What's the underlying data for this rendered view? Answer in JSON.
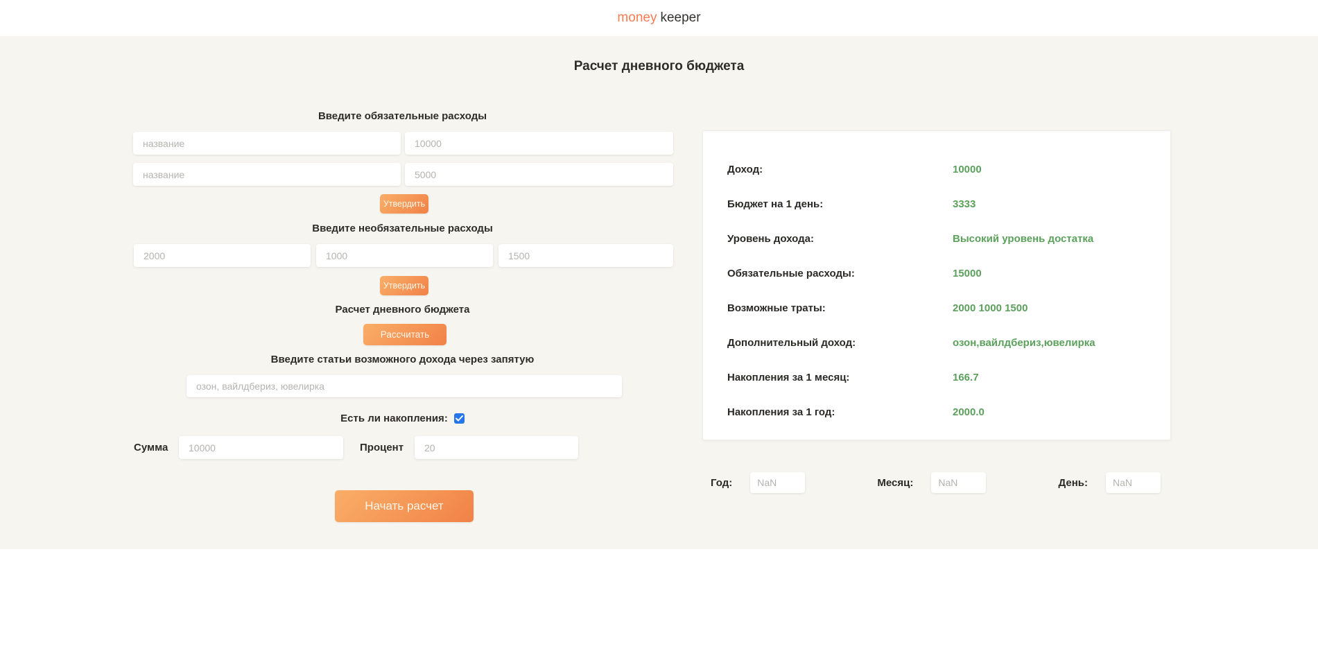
{
  "header": {
    "brand_accent": "money",
    "brand_rest": "keeper"
  },
  "page": {
    "title": "Расчет дневного бюджета"
  },
  "form": {
    "mandatory": {
      "label": "Введите обязательные расходы",
      "rows": [
        {
          "name_placeholder": "название",
          "amount_placeholder": "10000"
        },
        {
          "name_placeholder": "название",
          "amount_placeholder": "5000"
        }
      ],
      "submit_label": "Утвердить"
    },
    "optional": {
      "label": "Введите необязательные расходы",
      "placeholders": [
        "2000",
        "1000",
        "1500"
      ],
      "submit_label": "Утвердить"
    },
    "daily": {
      "label": "Расчет дневного бюджета",
      "calc_label": "Рассчитать"
    },
    "income_sources": {
      "label": "Введите статьи возможного дохода через запятую",
      "placeholder": "озон, вайлдбериз, ювелирка"
    },
    "savings": {
      "checkbox_label": "Есть ли накопления:",
      "checked": true,
      "sum_label": "Сумма",
      "sum_placeholder": "10000",
      "percent_label": "Процент",
      "percent_placeholder": "20"
    },
    "start_label": "Начать расчет"
  },
  "results": {
    "rows": [
      {
        "label": "Доход:",
        "value": "10000"
      },
      {
        "label": "Бюджет на 1 день:",
        "value": "3333"
      },
      {
        "label": "Уровень дохода:",
        "value": "Высокий уровень достатка"
      },
      {
        "label": "Обязательные расходы:",
        "value": "15000"
      },
      {
        "label": "Возможные траты:",
        "value": "2000 1000 1500"
      },
      {
        "label": "Дополнительный доход:",
        "value": "озон,вайлдбериз,ювелирка"
      },
      {
        "label": "Накопления за 1 месяц:",
        "value": "166.7"
      },
      {
        "label": "Накопления за 1 год:",
        "value": "2000.0"
      }
    ]
  },
  "date": {
    "fields": [
      {
        "label": "Год:",
        "value": "NaN"
      },
      {
        "label": "Месяц:",
        "value": "NaN"
      },
      {
        "label": "День:",
        "value": "NaN"
      }
    ]
  },
  "colors": {
    "brand_orange": "#f87b51",
    "button_gradient_start": "#f9ae68",
    "button_gradient_end": "#f18247",
    "result_green": "#5ba05b",
    "checkbox_blue": "#2577e8",
    "page_background": "#f7f5f0"
  }
}
